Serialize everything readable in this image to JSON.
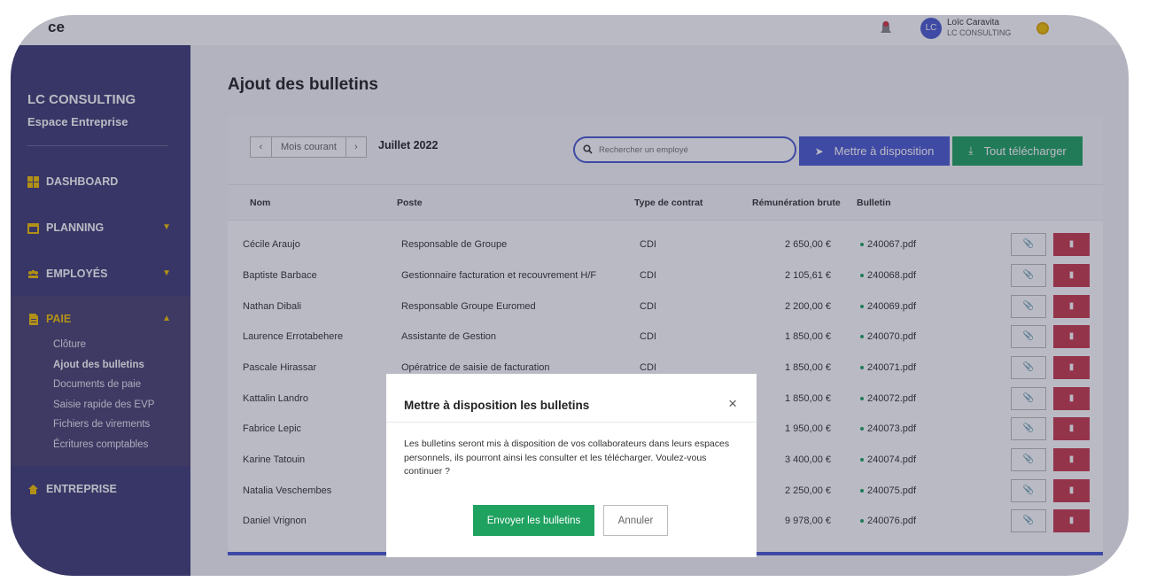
{
  "topbar": {
    "logo_fragment": "ce",
    "user_initials": "LC",
    "user_name": "Loïc Caravita",
    "user_company": "LC CONSULTING"
  },
  "sidebar": {
    "company": "LC CONSULTING",
    "space": "Espace Entreprise",
    "nav": {
      "dashboard": "DASHBOARD",
      "planning": "PLANNING",
      "employes": "EMPLOYÉS",
      "paie": "PAIE",
      "entreprise": "ENTREPRISE"
    },
    "paie_items": [
      "Clôture",
      "Ajout des bulletins",
      "Documents de paie",
      "Saisie rapide des EVP",
      "Fichiers de virements",
      "Écritures comptables"
    ],
    "accent_color": "#f2c200"
  },
  "main": {
    "title": "Ajout des bulletins",
    "month_nav": {
      "prev": "‹",
      "current": "Mois courant",
      "next": "›"
    },
    "month_label": "Juillet 2022",
    "search_placeholder": "Rechercher un employé",
    "dispo_label": "Mettre à disposition",
    "download_label": "Tout télécharger",
    "columns": [
      "Nom",
      "Poste",
      "Type de contrat",
      "Rémunération brute",
      "Bulletin"
    ],
    "rows": [
      {
        "nom": "Cécile Araujo",
        "poste": "Responsable de Groupe",
        "contrat": "CDI",
        "remuneration": "2 650,00 €",
        "bulletin": "240067.pdf"
      },
      {
        "nom": "Baptiste Barbace",
        "poste": "Gestionnaire facturation et recouvrement H/F",
        "contrat": "CDI",
        "remuneration": "2 105,61 €",
        "bulletin": "240068.pdf"
      },
      {
        "nom": "Nathan Dibali",
        "poste": "Responsable Groupe Euromed",
        "contrat": "CDI",
        "remuneration": "2 200,00 €",
        "bulletin": "240069.pdf"
      },
      {
        "nom": "Laurence Errotabehere",
        "poste": "Assistante de Gestion",
        "contrat": "CDI",
        "remuneration": "1 850,00 €",
        "bulletin": "240070.pdf"
      },
      {
        "nom": "Pascale Hirassar",
        "poste": "Opératrice de saisie de facturation",
        "contrat": "CDI",
        "remuneration": "1 850,00 €",
        "bulletin": "240071.pdf"
      },
      {
        "nom": "Kattalin Landro",
        "poste": "",
        "contrat": "",
        "remuneration": "1 850,00 €",
        "bulletin": "240072.pdf"
      },
      {
        "nom": "Fabrice Lepic",
        "poste": "",
        "contrat": "",
        "remuneration": "1 950,00 €",
        "bulletin": "240073.pdf"
      },
      {
        "nom": "Karine Tatouin",
        "poste": "",
        "contrat": "",
        "remuneration": "3 400,00 €",
        "bulletin": "240074.pdf"
      },
      {
        "nom": "Natalia Veschembes",
        "poste": "",
        "contrat": "",
        "remuneration": "2 250,00 €",
        "bulletin": "240075.pdf"
      },
      {
        "nom": "Daniel Vrignon",
        "poste": "",
        "contrat": "",
        "remuneration": "9 978,00 €",
        "bulletin": "240076.pdf"
      }
    ]
  },
  "modal": {
    "title": "Mettre à disposition les bulletins",
    "close": "×",
    "body": "Les bulletins seront mis à disposition de vos collaborateurs dans leurs espaces personnels, ils pourront ainsi les consulter et les télécharger. Voulez-vous continuer ?",
    "confirm_label": "Envoyer les bulletins",
    "cancel_label": "Annuler"
  },
  "colors": {
    "primary": "#4a5bd0",
    "success": "#1fa260",
    "danger": "#c73a4d",
    "sidebar": "#3e3d75"
  }
}
